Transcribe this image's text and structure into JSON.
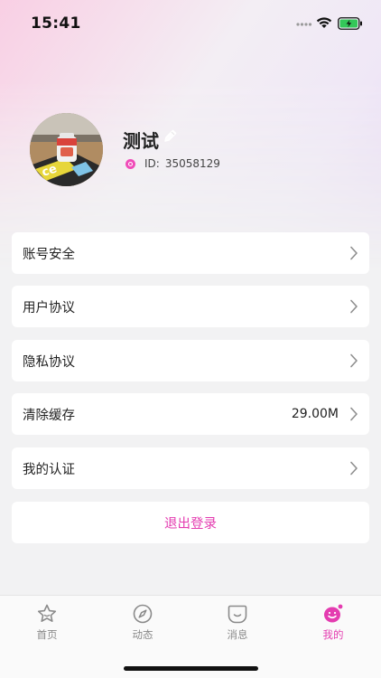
{
  "status": {
    "time": "15:41"
  },
  "profile": {
    "name": "测试",
    "id_label": "ID:",
    "id_value": "35058129"
  },
  "menu": {
    "items": [
      {
        "label": "账号安全",
        "value": ""
      },
      {
        "label": "用户协议",
        "value": ""
      },
      {
        "label": "隐私协议",
        "value": ""
      },
      {
        "label": "清除缓存",
        "value": "29.00M"
      },
      {
        "label": "我的认证",
        "value": ""
      }
    ],
    "logout_label": "退出登录"
  },
  "tabs": [
    {
      "label": "首页",
      "icon": "home-star-icon",
      "active": false
    },
    {
      "label": "动态",
      "icon": "compass-icon",
      "active": false
    },
    {
      "label": "消息",
      "icon": "message-face-icon",
      "active": false
    },
    {
      "label": "我的",
      "icon": "profile-face-icon",
      "active": true
    }
  ],
  "colors": {
    "accent": "#e43cb0",
    "background": "#f2f2f3",
    "inactive_tab": "#8a8a8a"
  }
}
